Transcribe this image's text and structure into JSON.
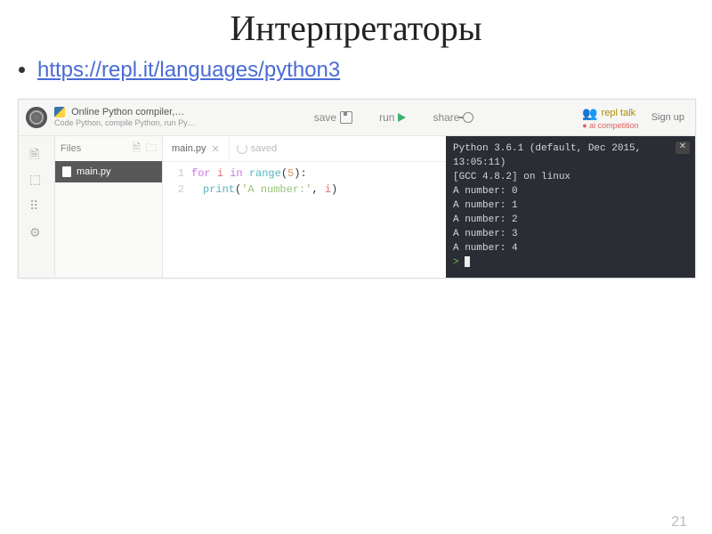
{
  "slide": {
    "title": "Интерпретаторы",
    "link": "https://repl.it/languages/python3",
    "page_number": "21"
  },
  "topbar": {
    "title_line1": "Online Python compiler,…",
    "title_line2": "Code Python, compile Python, run Py…",
    "save_label": "save",
    "run_label": "run",
    "share_label": "share",
    "repltalk_label": "repl talk",
    "competition_label": "ai competition",
    "signup_label": "Sign up"
  },
  "files": {
    "header": "Files",
    "items": [
      "main.py"
    ]
  },
  "tabs": {
    "active": "main.py",
    "saved_label": "saved"
  },
  "code": {
    "lines": [
      {
        "n": "1",
        "tokens": [
          {
            "t": "for ",
            "c": "kw"
          },
          {
            "t": "i",
            "c": "var"
          },
          {
            "t": " in ",
            "c": "kw"
          },
          {
            "t": "range",
            "c": "fn"
          },
          {
            "t": "("
          },
          {
            "t": "5",
            "c": "num"
          },
          {
            "t": "):"
          }
        ]
      },
      {
        "n": "2",
        "indent": true,
        "tokens": [
          {
            "t": "print",
            "c": "fn"
          },
          {
            "t": "("
          },
          {
            "t": "'A number:'",
            "c": "str"
          },
          {
            "t": ", "
          },
          {
            "t": "i",
            "c": "var"
          },
          {
            "t": ")"
          }
        ]
      }
    ]
  },
  "terminal": {
    "header1": "Python 3.6.1 (default, Dec 2015, 13:05:11)",
    "header2": "[GCC 4.8.2] on linux",
    "output": [
      "A number: 0",
      "A number: 1",
      "A number: 2",
      "A number: 3",
      "A number: 4"
    ],
    "prompt": ">"
  }
}
